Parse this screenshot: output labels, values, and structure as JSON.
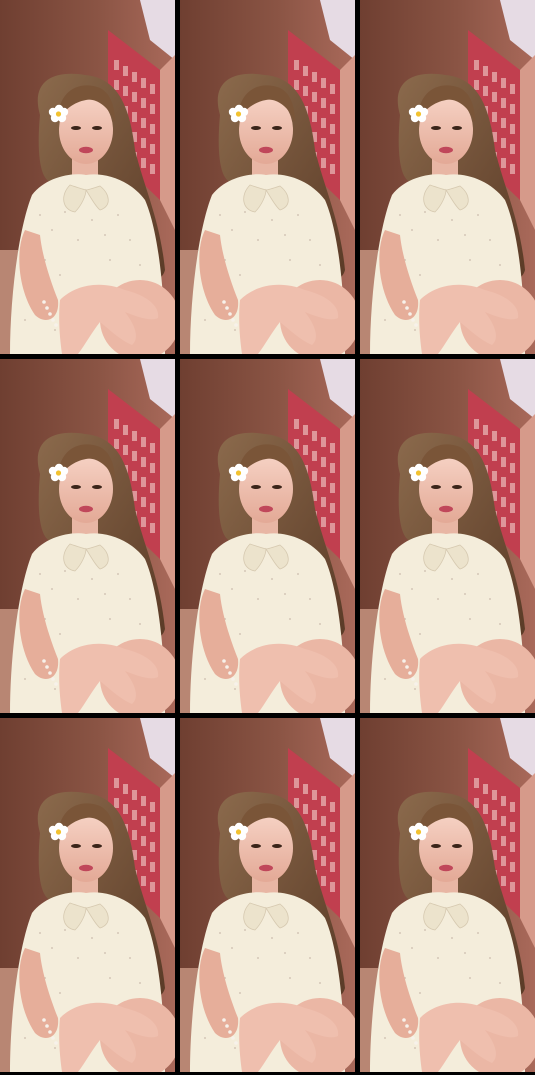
{
  "grid": {
    "rows": 3,
    "cols": 3,
    "tiles": [
      {
        "label": "frame"
      },
      {
        "label": "frame"
      },
      {
        "label": "frame"
      },
      {
        "label": "frame"
      },
      {
        "label": "frame"
      },
      {
        "label": "frame"
      },
      {
        "label": "frame"
      },
      {
        "label": "frame"
      },
      {
        "label": "frame"
      }
    ]
  },
  "colors": {
    "background": "#000000",
    "wall_left": "#7d4b3b",
    "wall_right": "#b36b5e",
    "window_red": "#c0394a",
    "sky": "#e9dde6",
    "hair": "#6b4630",
    "skin": "#f1c4b4",
    "dress": "#f3ecd9",
    "flower_petal": "#ffffff",
    "flower_center": "#f2c230"
  }
}
